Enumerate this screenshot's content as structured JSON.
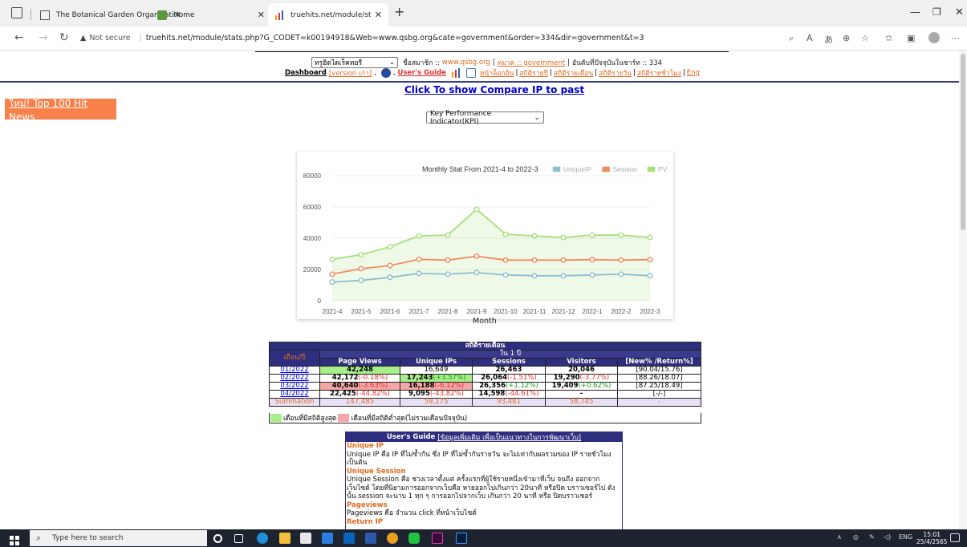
{
  "browser": {
    "tabs": [
      {
        "title": "The Botanical Garden Organizati",
        "active": false
      },
      {
        "title": "Home",
        "active": false
      },
      {
        "title": "truehits.net/module/stats.php?G",
        "active": true
      }
    ],
    "new_tab_label": "+",
    "security_label": "Not secure",
    "url": "truehits.net/module/stats.php?G_CODET=k00194918&Web=www.qsbg.org&cate=government&order=334&dir=government&t=3"
  },
  "header": {
    "site_select": "ทรูฮิตไดเร็คทอรี",
    "member_label": "ชื่อสมาชิก ::",
    "member_site": "www.qsbg.org",
    "category_label": "หมวด :: government",
    "rank_label": "อันดับที่ปัจจุบันในชาร์ท :: 334",
    "dashboard": "Dashboard",
    "old_version": "[version เก่า]",
    "users_guide": "User's Guide",
    "links": [
      "หน้าล็อกอิน",
      "สถิติรายปี",
      "สถิติรายเดือน",
      "สถิติรายวัน",
      "สถิติรายชั่วโมง",
      "Eng"
    ]
  },
  "compare_link": "Click To show Compare IP to past",
  "top100_button": "ใหม่! Top 100 Hit News",
  "kpi_select": "Key Performance Indicator(KPI)",
  "chart_data": {
    "type": "line",
    "title": "Monthly Stat From 2021-4 to 2022-3",
    "xlabel": "Month",
    "ylabel": "",
    "ylim": [
      0,
      80000
    ],
    "yticks": [
      0,
      20000,
      40000,
      60000,
      80000
    ],
    "grid": true,
    "legend": "top-right",
    "categories": [
      "2021-4",
      "2021-5",
      "2021-6",
      "2021-7",
      "2021-8",
      "2021-9",
      "2021-10",
      "2021-11",
      "2021-12",
      "2022-1",
      "2022-2",
      "2022-3"
    ],
    "series": [
      {
        "name": "UniqueIP",
        "color": "#8bbfcf",
        "values": [
          12000,
          13000,
          15000,
          17500,
          17000,
          18000,
          16500,
          16000,
          16000,
          16500,
          17000,
          16000
        ]
      },
      {
        "name": "Session",
        "color": "#f08a5d",
        "values": [
          17000,
          20500,
          22500,
          26500,
          26000,
          28500,
          26000,
          26000,
          26000,
          26300,
          26000,
          26300
        ]
      },
      {
        "name": "PV",
        "color": "#a6e07a",
        "values": [
          26500,
          29500,
          34500,
          41500,
          42000,
          58500,
          42500,
          41500,
          40500,
          42000,
          42000,
          40500
        ]
      }
    ]
  },
  "table": {
    "title": "สถิติรายเดือน",
    "month_header": "เดือน/ปี",
    "range_header": "ใน 1 ปี",
    "columns": [
      "Page Views",
      "Unique IPs",
      "Sessions",
      "Visitors",
      "[New% /Return%]"
    ],
    "rows": [
      {
        "month": "01/2022",
        "pv": "42,248",
        "pv_chg": "",
        "ip": "16,649",
        "ip_chg": "",
        "ses": "26,463",
        "ses_chg": "",
        "vis": "20,046",
        "vis_chg": "",
        "nr": "[90.04/15.76]"
      },
      {
        "month": "02/2022",
        "pv": "42,172",
        "pv_chg": "(-0.18%)",
        "ip": "17,243",
        "ip_chg": "(+3.57%)",
        "ses": "26,064",
        "ses_chg": "(-1.51%)",
        "vis": "19,290",
        "vis_chg": "(-3.77%)",
        "nr": "[88.26/18.07]"
      },
      {
        "month": "03/2022",
        "pv": "40,640",
        "pv_chg": "(-3.63%)",
        "ip": "16,188",
        "ip_chg": "(-6.12%)",
        "ses": "26,356",
        "ses_chg": "(+1.12%)",
        "vis": "19,409",
        "vis_chg": "(+0.62%)",
        "nr": "[87.25/18.49]"
      },
      {
        "month": "04/2022",
        "pv": "22,425",
        "pv_chg": "(-44.82%)",
        "ip": "9,095",
        "ip_chg": "(-43.82%)",
        "ses": "14,598",
        "ses_chg": "(-44.61%)",
        "vis": "-",
        "vis_chg": "",
        "nr": "[-/-]"
      }
    ],
    "summation": {
      "label": "Summation",
      "pv": "147,485",
      "ip": "59,175",
      "ses": "93,481",
      "vis": "58,745",
      "nr": "-"
    },
    "legend_high": "เดือนที่มีสถิติสูงสุด",
    "legend_low": "เดือนที่มีสถิติต่ำสุด(ไม่รวมเดือนปัจจุบัน)"
  },
  "guide": {
    "header": "User's Guide",
    "header_link": "[ข้อมูลเพิ่มเติม เพื่อเป็นแนวทางในการพัฒนาเว็บ]",
    "sections": [
      {
        "title": "Unique IP",
        "text": "Unique IP คือ IP ที่ไม่ซ้ำกัน ซึ่ง IP ที่ไม่ซ้ำกันรายวัน จะไม่เท่ากับผลรวมของ IP รายชั่วโมง เป็นต้น"
      },
      {
        "title": "Unique Session",
        "text": "Unique Session คือ ช่วงเวลาตั้งแต่ ครั้งแรกที่ผู้ใช้รายหนึ่งเข้ามาที่เว็บ จนถึง ออกจากเว็บไซต์ โดยที่นิยามการออกจากเว็บคือ หายออกไปเกินกว่า 20นาที หรือปิด บราวเซอร์ไป ดังนั้น session จะนาบ 1 ทุก ๆ การออกไปจากเว็บ เกินกว่า 20 นาที หรือ ปิดบราวเซอร์"
      },
      {
        "title": "Pageviews",
        "text": "Pageviews คือ จำนวน click ที่หน้าเว็บไซต์"
      },
      {
        "title": "Return IP",
        "text": ""
      }
    ]
  },
  "taskbar": {
    "search_placeholder": "Type here to search",
    "lang": "ENG",
    "time": "15:01",
    "date": "25/4/2565"
  }
}
